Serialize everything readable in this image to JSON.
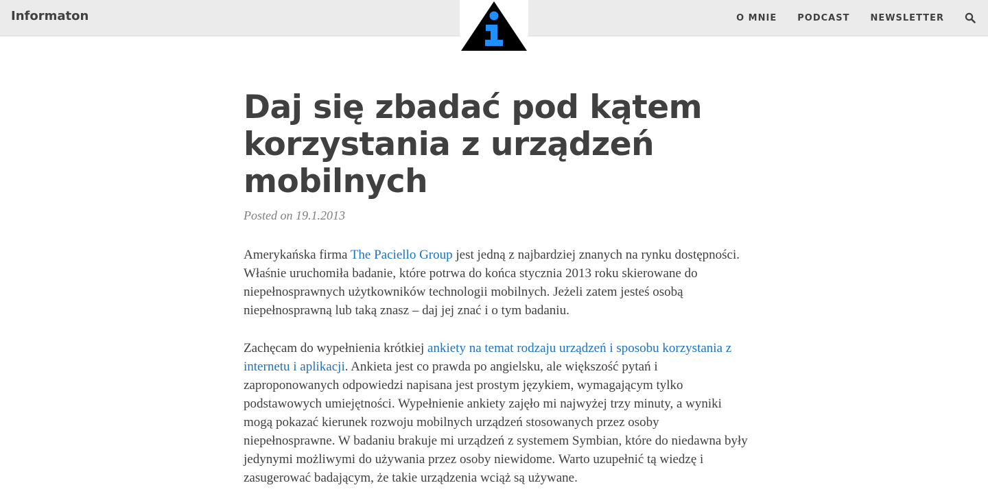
{
  "header": {
    "brand": "Informaton",
    "nav": [
      "O MNIE",
      "PODCAST",
      "NEWSLETTER"
    ],
    "search_icon": "search-icon",
    "logo_icon": "info-triangle-logo"
  },
  "article": {
    "title": "Daj się zbadać pod kątem korzystania z urządzeń mobilnych",
    "posted_prefix": "Posted on",
    "date": "19.1.2013",
    "p1": {
      "before": "Amerykańska firma ",
      "link": "The Paciello Group",
      "after": " jest jedną z najbardziej znanych na rynku dostępności. Właśnie uruchomiła badanie, które potrwa do końca stycznia 2013 roku skierowane do niepełnosprawnych użytkowników technologii mobilnych. Jeżeli zatem jesteś osobą niepełnosprawną lub taką znasz – daj jej znać i o tym badaniu."
    },
    "p2": {
      "before": "Zachęcam do wypełnienia krótkiej ",
      "link": "ankiety na temat rodzaju urządzeń i sposobu korzystania z internetu i aplikacji",
      "after": ". Ankieta jest co prawda po angielsku, ale większość pytań i zaproponowanych odpowiedzi napisana jest prostym językiem, wymagającym tylko podstawowych umiejętności. Wypełnienie ankiety zajęło mi najwyżej trzy minuty, a wyniki mogą pokazać kierunek rozwoju mobilnych urządzeń stosowanych przez osoby niepełnosprawne. W badaniu brakuje mi urządzeń z systemem Symbian, które do niedawna były jedynymi możliwymi do używania przez osoby niewidome. Warto uzupełnić tą wiedzę i zasugerować badającym, że takie urządzenia wciąż są używane."
    }
  },
  "colors": {
    "topbar": "#ebebeb",
    "text": "#404040",
    "link": "#1a73c7",
    "logo_blue": "#1e90ff",
    "logo_black": "#000000"
  }
}
